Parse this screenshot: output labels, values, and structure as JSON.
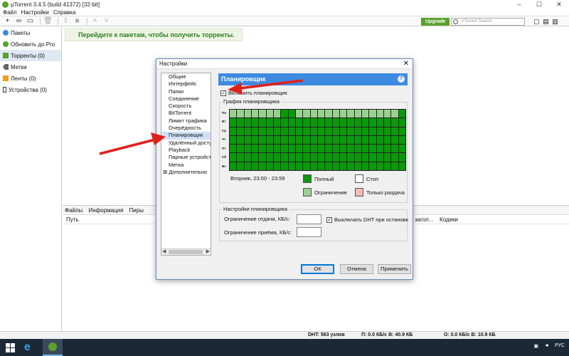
{
  "window": {
    "title": "µTorrent 3.4.5  (build 41372) [32-bit]"
  },
  "menu": [
    "Файл",
    "Настройки",
    "Справка"
  ],
  "toolbar": {
    "upgrade_label": "Upgrade",
    "search_placeholder": "uTorrent Search"
  },
  "sidebar": {
    "items": [
      {
        "label": "Пакеты"
      },
      {
        "label": "Обновить до Pro"
      },
      {
        "label": "Торренты (0)"
      },
      {
        "label": "Метки"
      },
      {
        "label": "Ленты (0)"
      },
      {
        "label": "Устройства (0)"
      }
    ]
  },
  "banner": {
    "text": "Перейдите к пакетам, чтобы получить торренты."
  },
  "bottom_panel": {
    "tabs": [
      "Файлы",
      "Информация",
      "Пиры"
    ],
    "columns": {
      "path": "Путь",
      "headers": "загол...",
      "codecs": "Кодеки"
    }
  },
  "status": {
    "dht": "DHT: 563 узлов",
    "down": "П: 0.0 КБ/с В: 40.9 КБ",
    "up": "О: 0.0 КБ/с В: 10.9 КБ"
  },
  "taskbar": {
    "lang": "РУС"
  },
  "dialog": {
    "title": "Настройки",
    "tree": [
      "Общие",
      "Интерфейс",
      "Папки",
      "Соединение",
      "Скорость",
      "BitTorrent",
      "Лимит трафика",
      "Очерёдность",
      "Планировщик",
      "Удалённый доступ",
      "Playback",
      "Парные устройства",
      "Метка",
      "Дополнительно"
    ],
    "selected_tree_item": "Планировщик",
    "panel_title": "Планировщик",
    "help_label": "?",
    "enable_label": "Включить планировщик",
    "enabled": true,
    "grid_label": "График планировщика",
    "day_labels": [
      "Пн",
      "Вт",
      "Ср",
      "Чт",
      "Пт",
      "Сб",
      "Вс"
    ],
    "hover_info": "Вторник, 23:00 - 23:59",
    "legend": {
      "full": "Полный",
      "stop": "Стоп",
      "limit": "Ограничение",
      "seed_only": "Только раздача"
    },
    "colors": {
      "full": "#089b08",
      "limit": "#9ad08f",
      "stop": "#ffffff",
      "seed_only": "#f4b8b8"
    },
    "schedule_monday_limited_hours": [
      0,
      1,
      2,
      3,
      4,
      5,
      6,
      9,
      10,
      11,
      12,
      13,
      14,
      15,
      16,
      17,
      18,
      19,
      20,
      21,
      22
    ],
    "settings_group_label": "Настройки планировщика",
    "upload_limit_label": "Ограничение отдачи, КБ/с:",
    "download_limit_label": "Ограничение приёма, КБ/с:",
    "upload_limit_value": "",
    "download_limit_value": "",
    "dht_off_label": "Выключать DHT при остановк",
    "dht_off_checked": true,
    "ok_label": "ОК",
    "cancel_label": "Отмена",
    "apply_label": "Применить"
  }
}
